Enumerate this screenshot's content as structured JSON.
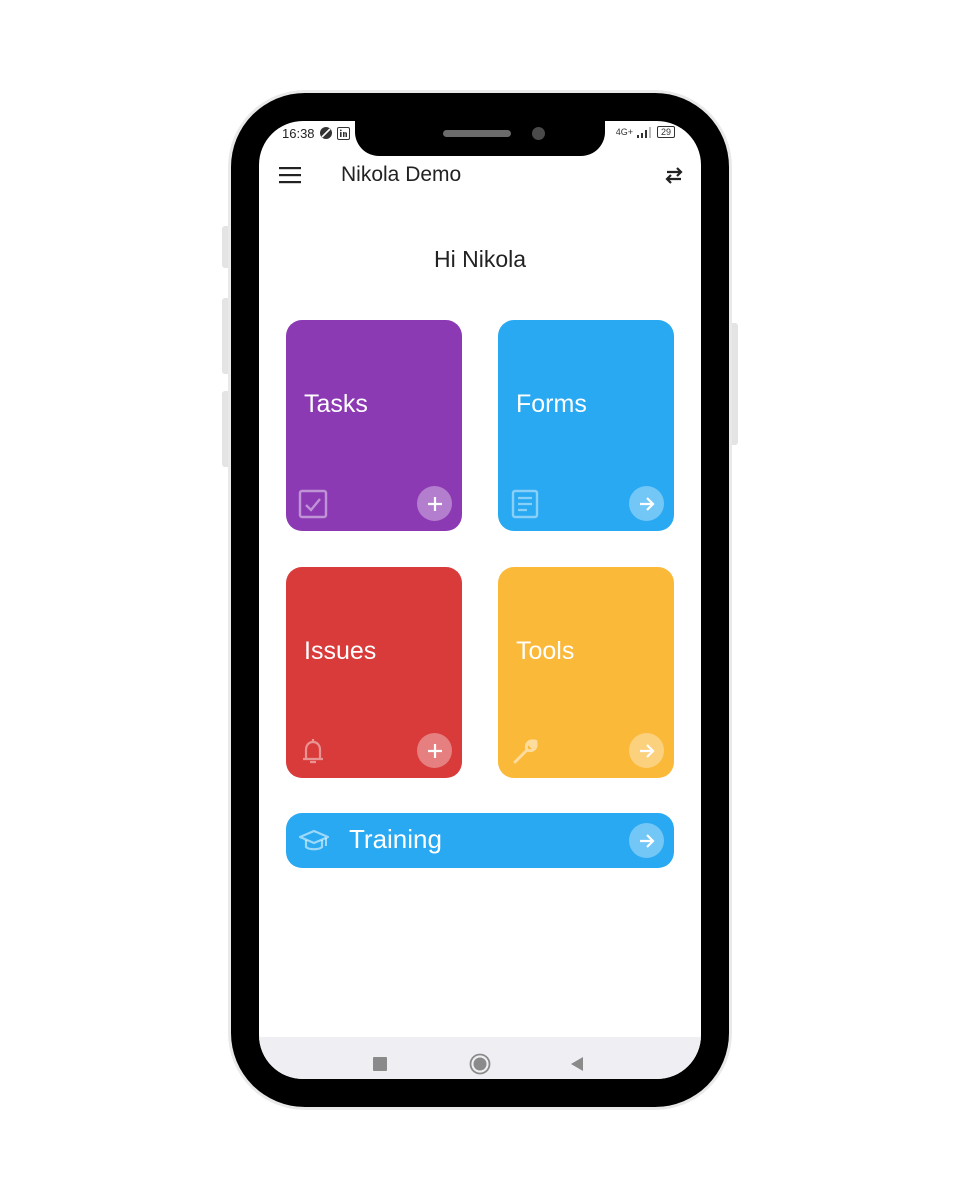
{
  "status_bar": {
    "time": "16:38",
    "battery": "29",
    "network": "4G+"
  },
  "app_bar": {
    "title": "Nikola Demo",
    "menu_icon": "hamburger-menu-icon",
    "switch_icon": "swap-arrows-icon"
  },
  "greeting": "Hi Nikola",
  "tiles": [
    {
      "label": "Tasks",
      "color": "#8c3ab4",
      "icon": "checkbox-icon",
      "action": "add-icon"
    },
    {
      "label": "Forms",
      "color": "#29a9f2",
      "icon": "document-icon",
      "action": "arrow-right-icon"
    },
    {
      "label": "Issues",
      "color": "#d93b3b",
      "icon": "bell-icon",
      "action": "add-icon"
    },
    {
      "label": "Tools",
      "color": "#fbb93a",
      "icon": "wrench-icon",
      "action": "arrow-right-icon"
    }
  ],
  "training": {
    "label": "Training",
    "color": "#29a9f2",
    "icon": "graduation-cap-icon",
    "action": "arrow-right-icon"
  }
}
